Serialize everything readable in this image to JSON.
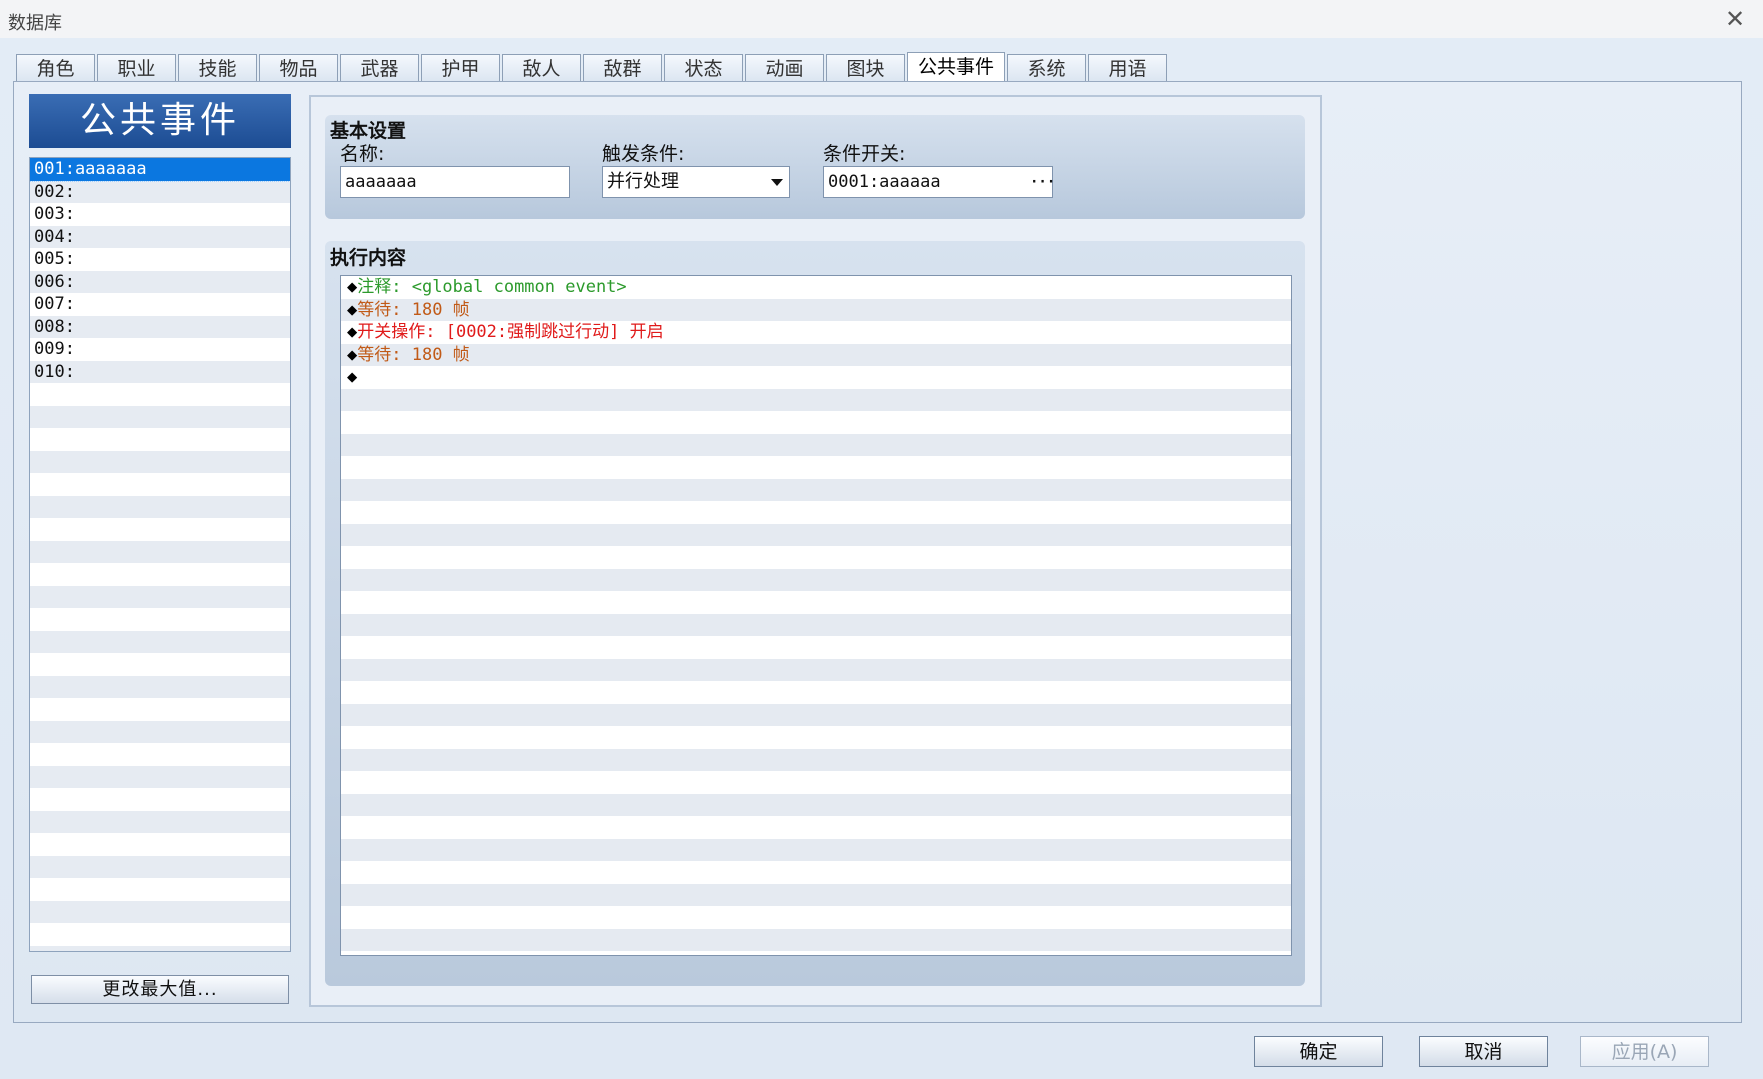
{
  "window": {
    "title": "数据库",
    "close_label": "✕"
  },
  "tabs": [
    {
      "label": "角色"
    },
    {
      "label": "职业"
    },
    {
      "label": "技能"
    },
    {
      "label": "物品"
    },
    {
      "label": "武器"
    },
    {
      "label": "护甲"
    },
    {
      "label": "敌人"
    },
    {
      "label": "敌群"
    },
    {
      "label": "状态"
    },
    {
      "label": "动画"
    },
    {
      "label": "图块"
    },
    {
      "label": "公共事件",
      "active": true
    },
    {
      "label": "系统"
    },
    {
      "label": "用语"
    }
  ],
  "left": {
    "header": "公共事件",
    "items": [
      "001:aaaaaaa",
      "002:",
      "003:",
      "004:",
      "005:",
      "006:",
      "007:",
      "008:",
      "009:",
      "010:"
    ],
    "selected_index": 0,
    "change_max_label": "更改最大值..."
  },
  "basic": {
    "title": "基本设置",
    "name_label": "名称:",
    "name_value": "aaaaaaa",
    "trigger_label": "触发条件:",
    "trigger_value": "并行处理",
    "switch_label": "条件开关:",
    "switch_value": "0001:aaaaaa",
    "switch_button": "···"
  },
  "exec": {
    "title": "执行内容",
    "commands": [
      {
        "bullet": "◆",
        "text": "注释: <global common event>",
        "color": "#2c9a2c"
      },
      {
        "bullet": "◆",
        "text": "等待: 180 帧",
        "color": "#c15a17"
      },
      {
        "bullet": "◆",
        "text": "开关操作: [0002:强制跳过行动] 开启",
        "color": "#e01a1a"
      },
      {
        "bullet": "◆",
        "text": "等待: 180 帧",
        "color": "#c15a17"
      },
      {
        "bullet": "◆",
        "text": "",
        "color": "#000000"
      }
    ]
  },
  "buttons": {
    "ok": "确定",
    "cancel": "取消",
    "apply": "应用(A)"
  }
}
